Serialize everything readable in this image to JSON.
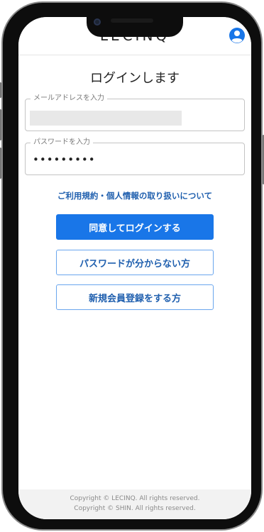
{
  "app": {
    "logo": "LECINQ"
  },
  "header": {
    "account_icon": "account-circle-icon",
    "accent": "#1976e8"
  },
  "login": {
    "title": "ログインします",
    "email_label": "メールアドレスを入力",
    "email_value": "",
    "password_label": "パスワードを入力",
    "password_value": "•••••••••",
    "terms_link": "ご利用規約・個人情報の取り扱いについて",
    "login_button": "同意してログインする",
    "forgot_button": "パスワードが分からない方",
    "register_button": "新規会員登録をする方"
  },
  "footer": {
    "copyright_1": "Copyright © LECINQ. All rights reserved.",
    "copyright_2": "Copyright © SHIN. All rights reserved."
  }
}
